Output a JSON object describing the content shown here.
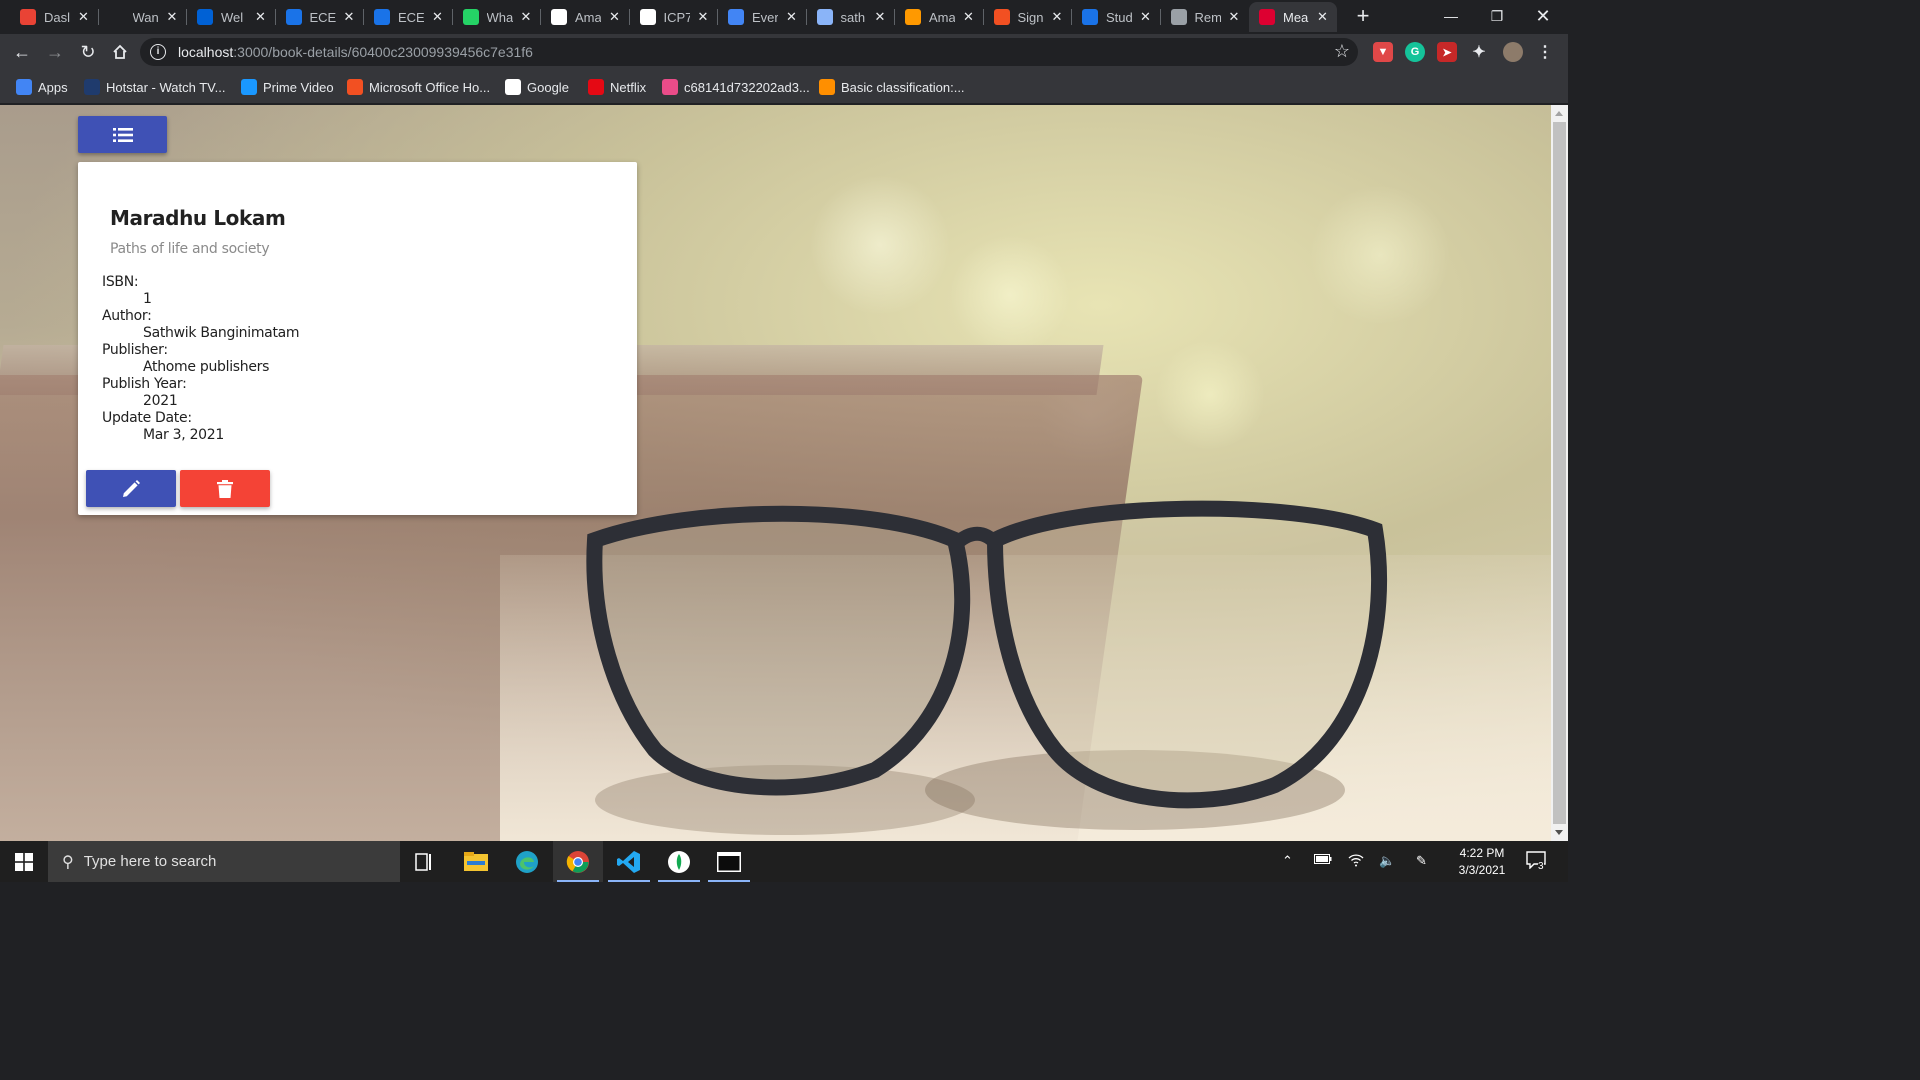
{
  "browser": {
    "tabs": [
      {
        "title": "Dasl",
        "icon": "dashboard-icon",
        "color": "#e94335"
      },
      {
        "title": "Wan",
        "icon": "wandb-icon",
        "color": "#202124"
      },
      {
        "title": "Wel",
        "icon": "box-icon",
        "color": "#0061d5"
      },
      {
        "title": "ECE",
        "icon": "ece-icon",
        "color": "#1a73e8"
      },
      {
        "title": "ECE",
        "icon": "ece-icon",
        "color": "#1a73e8"
      },
      {
        "title": "Wha",
        "icon": "whatsapp-icon",
        "color": "#25d366"
      },
      {
        "title": "Ama",
        "icon": "amazon-icon",
        "color": "#ffffff"
      },
      {
        "title": "ICP7",
        "icon": "github-icon",
        "color": "#ffffff"
      },
      {
        "title": "Ever",
        "icon": "evernote-icon",
        "color": "#4285f4"
      },
      {
        "title": "sath",
        "icon": "server-icon",
        "color": "#8ab4f8"
      },
      {
        "title": "Ama",
        "icon": "aws-icon",
        "color": "#ff9900"
      },
      {
        "title": "Sign",
        "icon": "microsoft-icon",
        "color": "#f25022"
      },
      {
        "title": "Stud",
        "icon": "ece-icon",
        "color": "#1a73e8"
      },
      {
        "title": "Rem",
        "icon": "globe-icon",
        "color": "#9aa0a6"
      },
      {
        "title": "Mea",
        "icon": "angular-icon",
        "color": "#dd0031"
      }
    ],
    "active_tab_index": 14,
    "url_host": "localhost",
    "url_path": ":3000/book-details/60400c23009939456c7e31f6",
    "bookmarks": [
      {
        "label": "Apps",
        "icon": "apps-grid-icon",
        "color": "#4285f4"
      },
      {
        "label": "Hotstar - Watch TV...",
        "icon": "hotstar-icon",
        "color": "#1f3b6d"
      },
      {
        "label": "Prime Video",
        "icon": "prime-video-icon",
        "color": "#1a98ff"
      },
      {
        "label": "Microsoft Office Ho...",
        "icon": "microsoft-icon",
        "color": "#f25022"
      },
      {
        "label": "Google",
        "icon": "google-icon",
        "color": "#ffffff"
      },
      {
        "label": "Netflix",
        "icon": "netflix-icon",
        "color": "#e50914"
      },
      {
        "label": "c68141d732202ad3...",
        "icon": "dribbble-icon",
        "color": "#ea4c89"
      },
      {
        "label": "Basic classification:...",
        "icon": "tensorflow-icon",
        "color": "#ff8f00"
      }
    ]
  },
  "app": {
    "accent": "#3f51b5",
    "danger": "#f44336",
    "book": {
      "title": "Maradhu Lokam",
      "description": "Paths of life and society",
      "fields": [
        {
          "label": "ISBN:",
          "value": "1"
        },
        {
          "label": "Author:",
          "value": "Sathwik Banginimatam"
        },
        {
          "label": "Publisher:",
          "value": "Athome publishers"
        },
        {
          "label": "Publish Year:",
          "value": "2021"
        },
        {
          "label": "Update Date:",
          "value": "Mar 3, 2021"
        }
      ]
    }
  },
  "taskbar": {
    "search_placeholder": "Type here to search",
    "time": "4:22 PM",
    "date": "3/3/2021",
    "notification_count": "3"
  }
}
